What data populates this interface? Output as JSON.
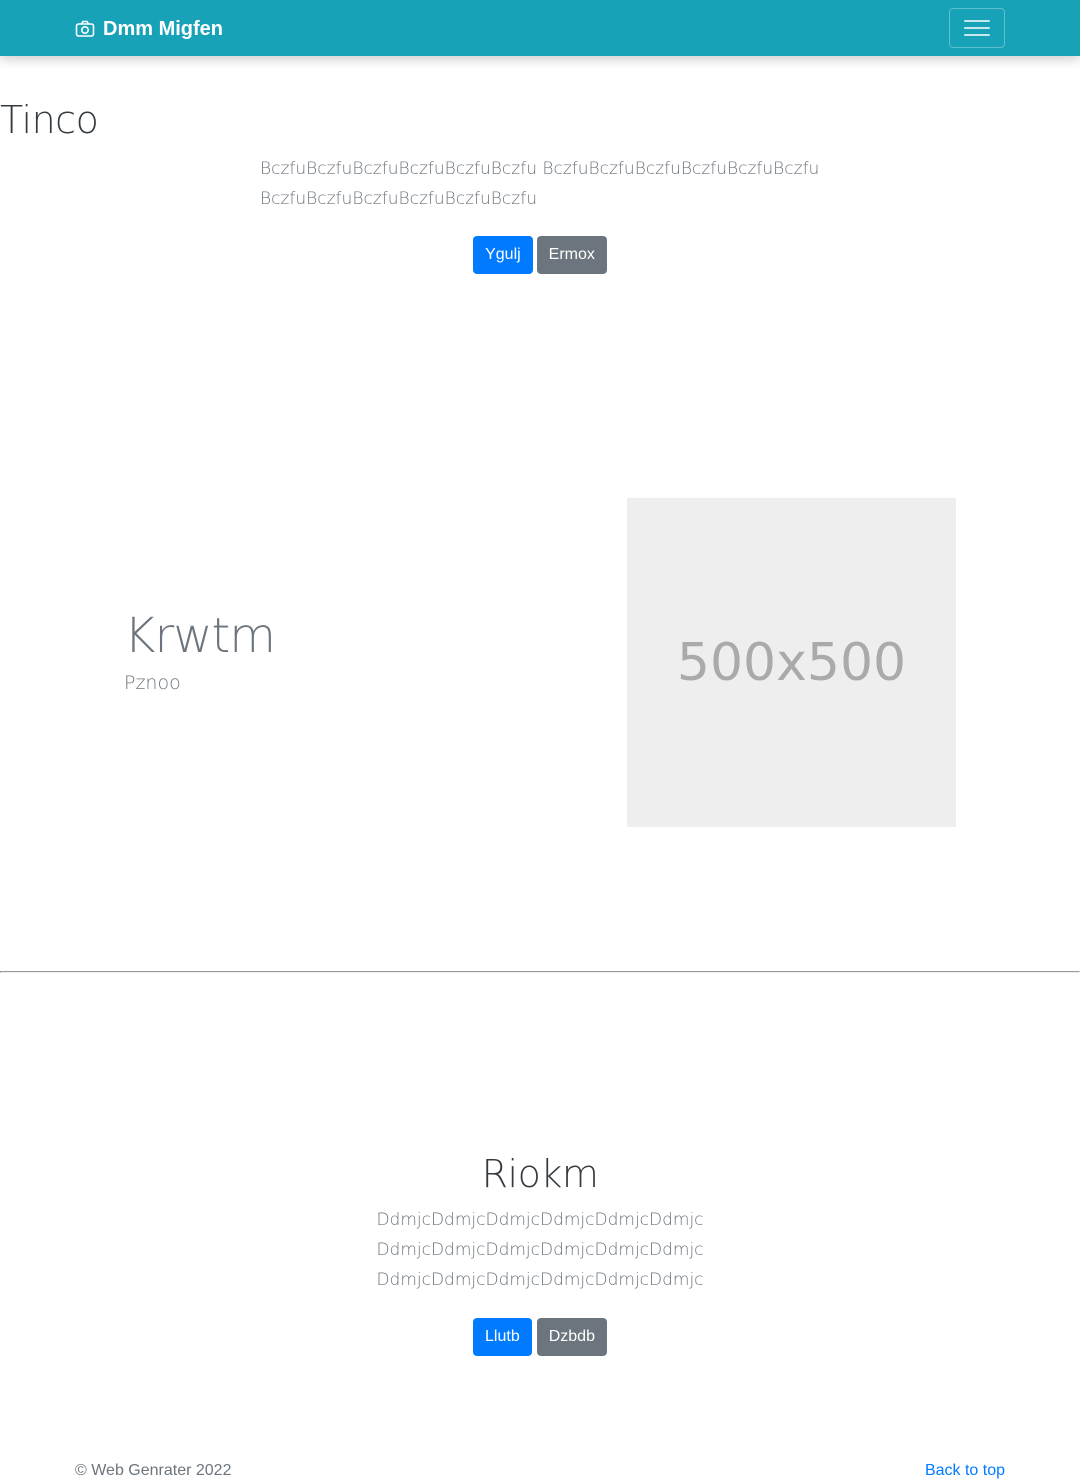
{
  "navbar": {
    "brand": "Dmm Migfen",
    "brand_icon": "camera-icon",
    "toggler_icon": "hamburger-menu-icon",
    "background": "#17a2b8"
  },
  "hero": {
    "title": "Tinco",
    "lead": "BczfuBczfuBczfuBczfuBczfuBczfu BczfuBczfuBczfuBczfuBczfuBczfu BczfuBczfuBczfuBczfuBczfuBczfu",
    "primary_button": "Ygulj",
    "secondary_button": "Ermox"
  },
  "feature": {
    "title": "Krwtm",
    "text": "Pznoo",
    "image_placeholder": "500x500"
  },
  "section": {
    "title": "Riokm",
    "lead": "DdmjcDdmjcDdmjcDdmjcDdmjcDdmjc DdmjcDdmjcDdmjcDdmjcDdmjcDdmjc DdmjcDdmjcDdmjcDdmjcDdmjcDdmjc",
    "primary_button": "Llutb",
    "secondary_button": "Dzbdb"
  },
  "footer": {
    "copyright": "© Web Genrater 2022",
    "back_to_top": "Back to top"
  },
  "colors": {
    "primary": "#007bff",
    "secondary": "#6c757d",
    "info": "#17a2b8"
  }
}
